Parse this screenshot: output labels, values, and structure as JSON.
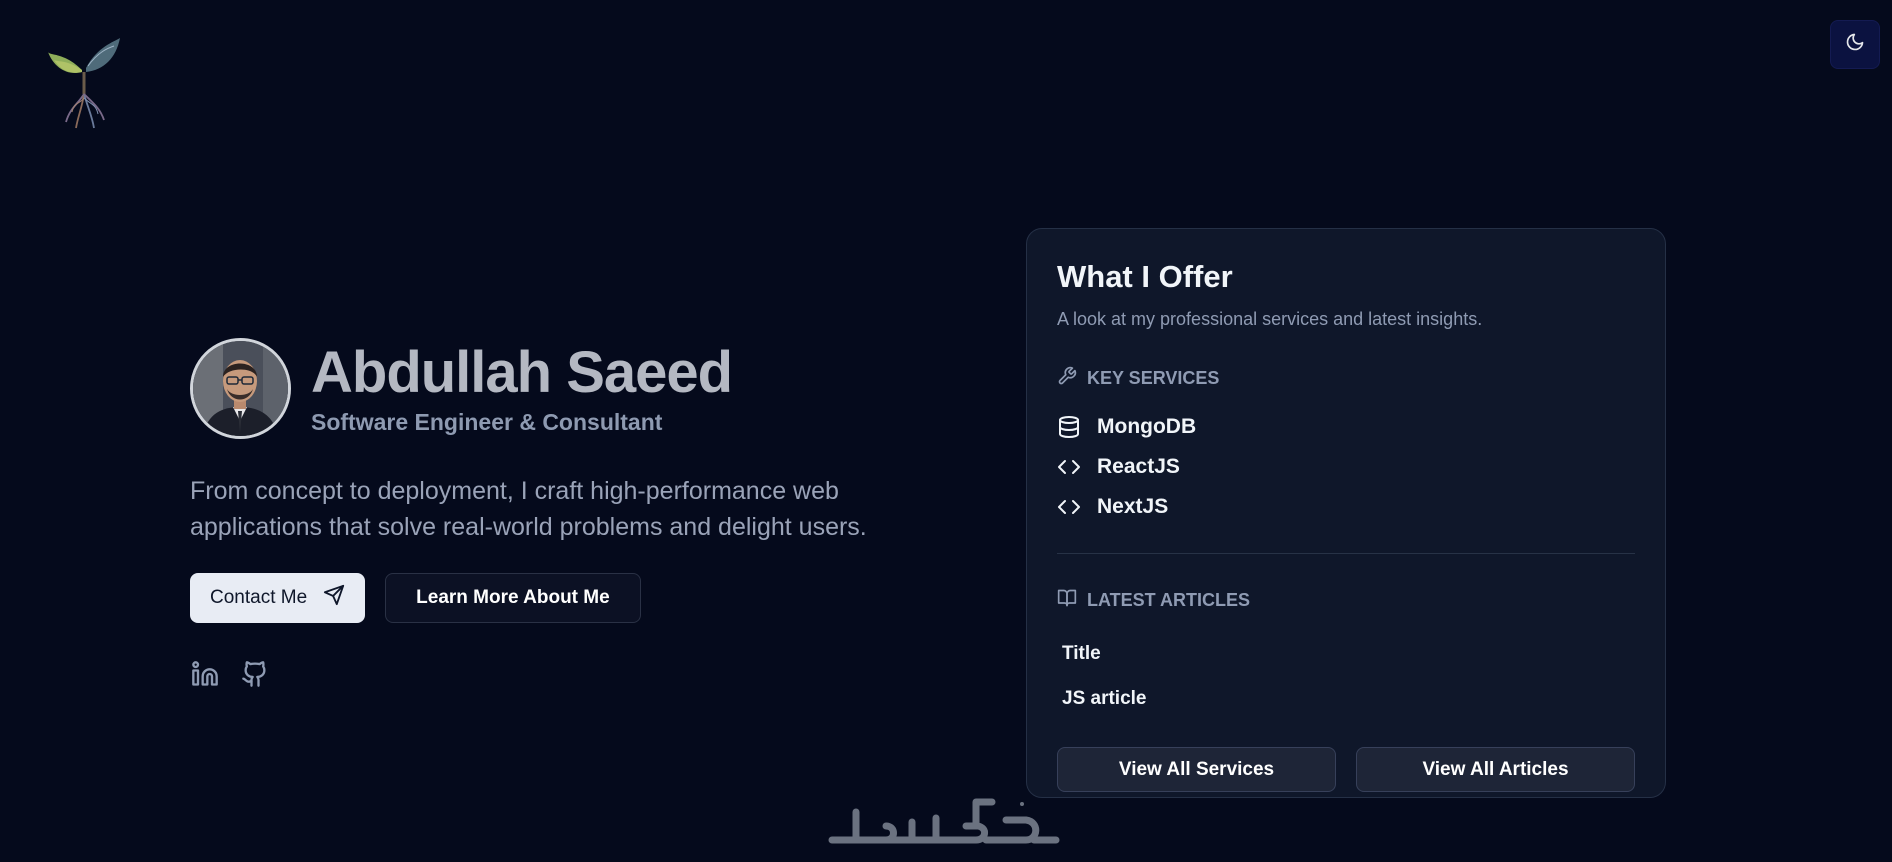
{
  "header": {
    "logo_icon": "sprout-tree-logo",
    "theme_toggle_icon": "moon-icon"
  },
  "hero": {
    "name": "Abdullah Saeed",
    "role": "Software Engineer & Consultant",
    "tagline": "From concept to deployment, I craft high-performance web applications that solve real-world problems and delight users.",
    "contact_label": "Contact Me",
    "contact_icon": "send-icon",
    "learn_more_label": "Learn More About Me",
    "socials": [
      {
        "icon": "linkedin-icon"
      },
      {
        "icon": "github-icon"
      }
    ]
  },
  "offer": {
    "title": "What I Offer",
    "subtitle": "A look at my professional services and latest insights.",
    "services_heading": "Key Services",
    "services": [
      {
        "label": "MongoDB",
        "icon": "database-icon"
      },
      {
        "label": "ReactJS",
        "icon": "code-icon"
      },
      {
        "label": "NextJS",
        "icon": "code-icon"
      }
    ],
    "articles_heading": "Latest Articles",
    "articles": [
      {
        "title": "Title"
      },
      {
        "title": "JS article"
      }
    ],
    "view_services_label": "View All Services",
    "view_articles_label": "View All Articles"
  },
  "watermark": {
    "text": "خمسات"
  },
  "colors": {
    "background": "#050a1c",
    "card": "#0f172a",
    "accent_button": "#e8ecf4",
    "toggle_bg": "#0b1240"
  }
}
